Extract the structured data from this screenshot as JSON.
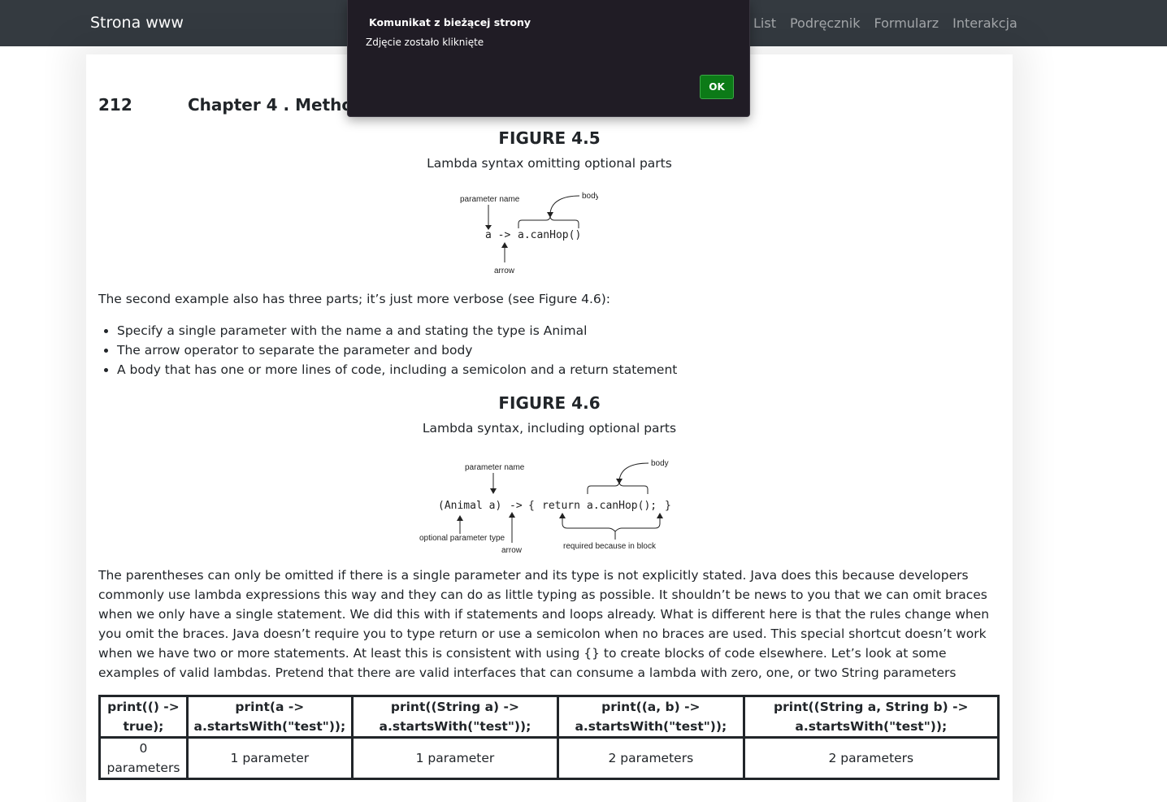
{
  "navbar": {
    "brand": "Strona www",
    "links": [
      "List",
      "Podręcznik",
      "Formularz",
      "Interakcja"
    ]
  },
  "page": {
    "page_number": "212",
    "chapter_title": "Chapter 4 . Methods a",
    "figure1": {
      "title": "FIGURE 4.5",
      "caption": "Lambda syntax omitting optional parts",
      "labels": {
        "parameter_name": "parameter name",
        "body": "body",
        "arrow": "arrow",
        "code_param": "a ->",
        "code_body": "a.canHop()"
      }
    },
    "intro_text": "The second example also has three parts; it’s just more verbose (see Figure 4.6):",
    "bullets": [
      "Specify a single parameter with the name a and stating the type is Animal",
      "The arrow operator to separate the parameter and body",
      "A body that has one or more lines of code, including a semicolon and a return statement"
    ],
    "figure2": {
      "title": "FIGURE 4.6",
      "caption": "Lambda syntax, including optional parts",
      "labels": {
        "parameter_name": "parameter name",
        "body": "body",
        "optional_type": "optional parameter type",
        "arrow": "arrow",
        "required": "required because in block",
        "code_params": "(Animal a)",
        "code_arrow": "->",
        "code_open": "{",
        "code_return": "return",
        "code_body": "a.canHop();",
        "code_close": "}"
      }
    },
    "body_text": "The parentheses can only be omitted if there is a single parameter and its type is not explicitly stated. Java does this because developers commonly use lambda expressions this way and they can do as little typing as possible. It shouldn’t be news to you that we can omit braces when we only have a single statement. We did this with if statements and loops already. What is different here is that the rules change when you omit the braces. Java doesn’t require you to type return or use a semicolon when no braces are used. This special shortcut doesn’t work when we have two or more statements. At least this is consistent with using {} to create blocks of code elsewhere. Let’s look at some examples of valid lambdas. Pretend that there are valid interfaces that can consume a lambda with zero, one, or two String parameters",
    "table": {
      "headers": [
        "print(() -> true);",
        "print(a -> a.startsWith(\"test\"));",
        "print((String a) -> a.startsWith(\"test\"));",
        "print((a, b) -> a.startsWith(\"test\"));",
        "print((String a, String b) -> a.startsWith(\"test\"));"
      ],
      "row": [
        "0 parameters",
        "1 parameter",
        "1 parameter",
        "2 parameters",
        "2 parameters"
      ]
    }
  },
  "dialog": {
    "title": "Komunikat z bieżącej strony",
    "message": "Zdjęcie zostało kliknięte",
    "ok_label": "OK"
  },
  "colors": {
    "navbar_bg": "#343a40",
    "dialog_bg": "#201c25",
    "ok_button": "#0c7a17"
  }
}
